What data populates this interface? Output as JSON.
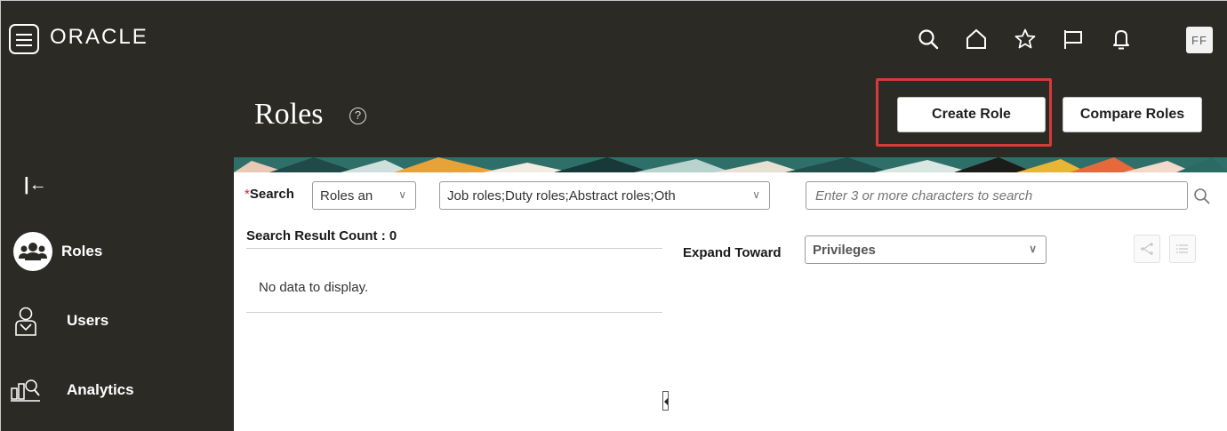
{
  "brand": {
    "logo_text": "ORACLE"
  },
  "topbar": {
    "icons": [
      "search-icon",
      "home-icon",
      "favorites-icon",
      "flag-icon",
      "bell-icon"
    ],
    "avatar_initials": "FF"
  },
  "header": {
    "title": "Roles",
    "help_glyph": "?",
    "create_role_label": "Create Role",
    "compare_roles_label": "Compare Roles"
  },
  "sidebar": {
    "collapse_glyph": "|←",
    "items": [
      {
        "label": "Roles",
        "icon": "roles-group-icon",
        "selected": true
      },
      {
        "label": "Users",
        "icon": "user-icon",
        "selected": false
      },
      {
        "label": "Analytics",
        "icon": "analytics-icon",
        "selected": false
      }
    ]
  },
  "search": {
    "required_marker": "*",
    "label": "Search",
    "scope_value": "Roles an",
    "role_types_value": "Job roles;Duty roles;Abstract roles;Oth",
    "placeholder": "Enter 3 or more characters to search"
  },
  "results": {
    "count_label": "Search Result Count : 0",
    "empty_message": "No data to display."
  },
  "expand": {
    "label": "Expand Toward",
    "value": "Privileges"
  },
  "colors": {
    "dark_bg": "#2b2a25",
    "highlight_border": "#d63a3a",
    "accent_teal": "#2f6f6a"
  }
}
